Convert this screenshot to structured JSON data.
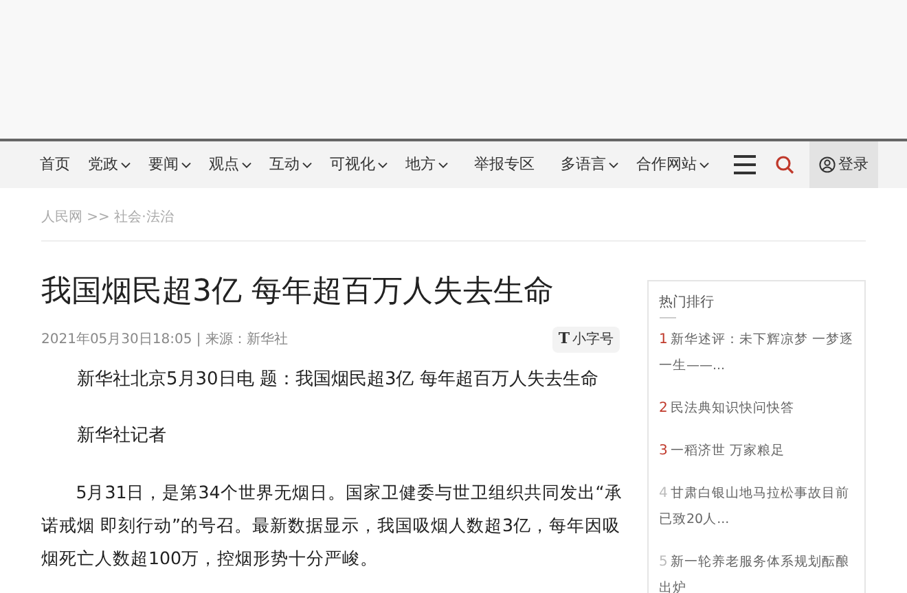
{
  "nav": {
    "items": [
      {
        "label": "首页",
        "dropdown": false
      },
      {
        "label": "党政",
        "dropdown": true
      },
      {
        "label": "要闻",
        "dropdown": true
      },
      {
        "label": "观点",
        "dropdown": true
      },
      {
        "label": "互动",
        "dropdown": true
      },
      {
        "label": "可视化",
        "dropdown": true
      },
      {
        "label": "地方",
        "dropdown": true
      },
      {
        "label": "举报专区",
        "dropdown": false
      },
      {
        "label": "多语言",
        "dropdown": true
      },
      {
        "label": "合作网站",
        "dropdown": true
      }
    ],
    "login": "登录"
  },
  "breadcrumb": "人民网 >> 社会·法治",
  "article": {
    "title": "我国烟民超3亿 每年超百万人失去生命",
    "meta": "2021年05月30日18:05 | 来源：新华社",
    "font_size_button": "小字号",
    "font_size_icon": "T",
    "paragraphs": [
      "新华社北京5月30日电 题：我国烟民超3亿 每年超百万人失去生命",
      "新华社记者",
      "5月31日，是第34个世界无烟日。国家卫健委与世卫组织共同发出“承诺戒烟 即刻行动”的号召。最新数据显示，我国吸烟人数超3亿，每年因吸烟死亡人数超100万，控烟形势十分严峻。"
    ]
  },
  "sidebar": {
    "title": "热门排行",
    "items": [
      {
        "rank": "1",
        "text": "新华述评：未下辉凉梦 一梦逐一生——...",
        "color": "#c0392b"
      },
      {
        "rank": "2",
        "text": "民法典知识快问快答",
        "color": "#c0392b"
      },
      {
        "rank": "3",
        "text": "一稻济世 万家粮足",
        "color": "#c0392b"
      },
      {
        "rank": "4",
        "text": "甘肃白银山地马拉松事故目前已致20人...",
        "color": "#bbbbbb"
      },
      {
        "rank": "5",
        "text": "新一轮养老服务体系规划酝酿出炉",
        "color": "#bbbbbb"
      }
    ]
  }
}
